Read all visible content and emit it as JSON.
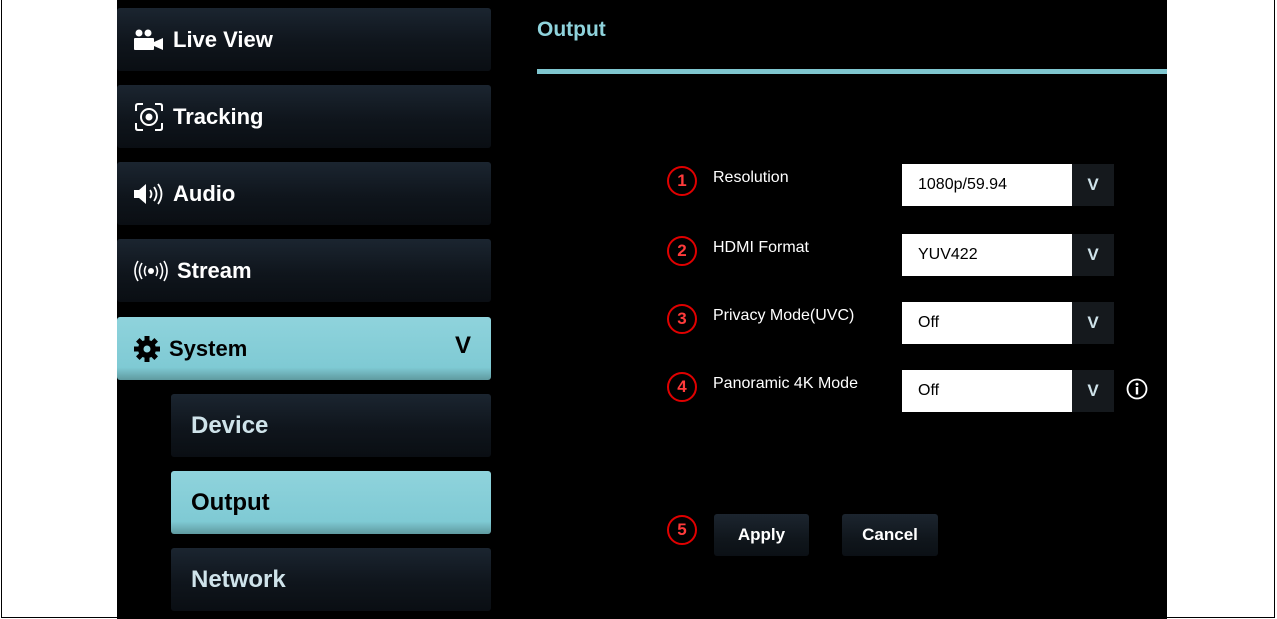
{
  "sidebar": {
    "items": [
      {
        "label": "Live View",
        "icon": "camera-icon"
      },
      {
        "label": "Tracking",
        "icon": "tracking-icon"
      },
      {
        "label": "Audio",
        "icon": "speaker-icon"
      },
      {
        "label": "Stream",
        "icon": "broadcast-icon"
      },
      {
        "label": "System",
        "icon": "gear-icon",
        "expanded": true,
        "chevron": "V"
      }
    ],
    "subitems": [
      {
        "label": "Device"
      },
      {
        "label": "Output",
        "active": true
      },
      {
        "label": "Network"
      }
    ]
  },
  "page": {
    "title": "Output"
  },
  "fields": [
    {
      "number": "1",
      "label": "Resolution",
      "value": "1080p/59.94",
      "arrow": "V"
    },
    {
      "number": "2",
      "label": "HDMI Format",
      "value": "YUV422",
      "arrow": "V"
    },
    {
      "number": "3",
      "label": "Privacy Mode(UVC)",
      "value": "Off",
      "arrow": "V"
    },
    {
      "number": "4",
      "label": "Panoramic 4K Mode",
      "value": "Off",
      "arrow": "V"
    }
  ],
  "actions": {
    "number": "5",
    "apply_label": "Apply",
    "cancel_label": "Cancel"
  },
  "colors": {
    "accent": "#8fd3dc",
    "background": "#000000",
    "badge": "#e00000"
  }
}
